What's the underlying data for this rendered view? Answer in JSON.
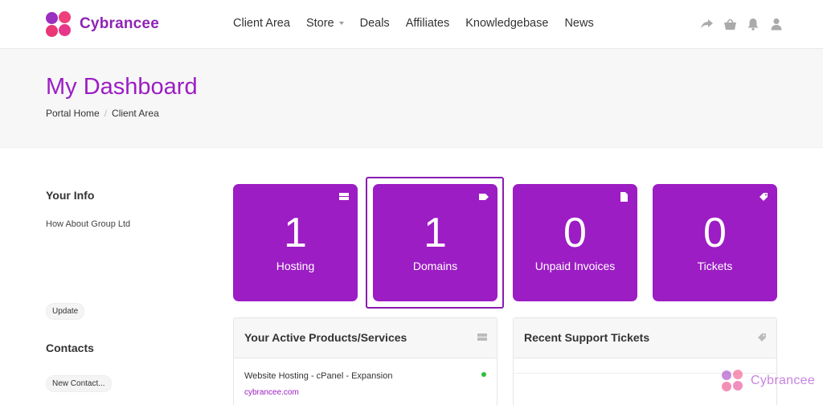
{
  "brand": {
    "name": "Cybrancee",
    "accent": "#9c1dc4"
  },
  "nav": {
    "items": [
      {
        "label": "Client Area"
      },
      {
        "label": "Store"
      },
      {
        "label": "Deals"
      },
      {
        "label": "Affiliates"
      },
      {
        "label": "Knowledgebase"
      },
      {
        "label": "News"
      }
    ],
    "icons": [
      "share-icon",
      "basket-icon",
      "bell-icon",
      "user-icon"
    ]
  },
  "page": {
    "title": "My Dashboard",
    "breadcrumb": [
      "Portal Home",
      "Client Area"
    ]
  },
  "sidebar": {
    "your_info_heading": "Your Info",
    "company": "How About Group Ltd",
    "update_label": "Update",
    "contacts_heading": "Contacts",
    "new_contact_label": "New Contact..."
  },
  "tiles": [
    {
      "count": "1",
      "label": "Hosting",
      "icon": "server-icon"
    },
    {
      "count": "1",
      "label": "Domains",
      "icon": "tag-icon"
    },
    {
      "count": "0",
      "label": "Unpaid Invoices",
      "icon": "document-icon"
    },
    {
      "count": "0",
      "label": "Tickets",
      "icon": "ticket-icon"
    }
  ],
  "panels": {
    "products": {
      "title": "Your Active Products/Services",
      "service_name": "Website Hosting - cPanel - Expansion",
      "service_domain": "cybrancee.com",
      "status_color": "#27c23a"
    },
    "tickets": {
      "title": "Recent Support Tickets"
    }
  },
  "watermark": {
    "text": "Cybrancee"
  }
}
